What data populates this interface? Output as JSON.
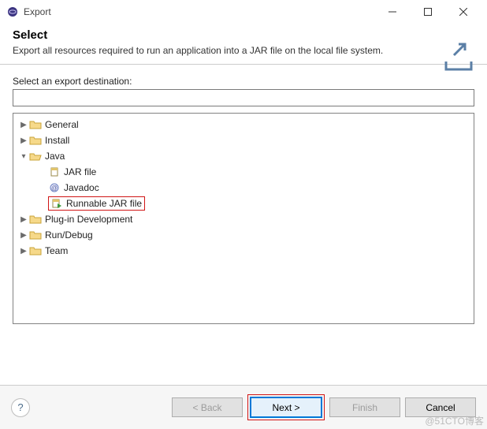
{
  "window": {
    "title": "Export"
  },
  "header": {
    "title": "Select",
    "description": "Export all resources required to run an application into a JAR file on the local file system."
  },
  "filter": {
    "label": "Select an export destination:",
    "value": ""
  },
  "tree": {
    "general": "General",
    "install": "Install",
    "java": "Java",
    "java_children": {
      "jar": "JAR file",
      "javadoc": "Javadoc",
      "runnable": "Runnable JAR file"
    },
    "plugin": "Plug-in Development",
    "rundebug": "Run/Debug",
    "team": "Team"
  },
  "buttons": {
    "back": "< Back",
    "next": "Next >",
    "finish": "Finish",
    "cancel": "Cancel"
  },
  "watermark": "@51CTO博客"
}
